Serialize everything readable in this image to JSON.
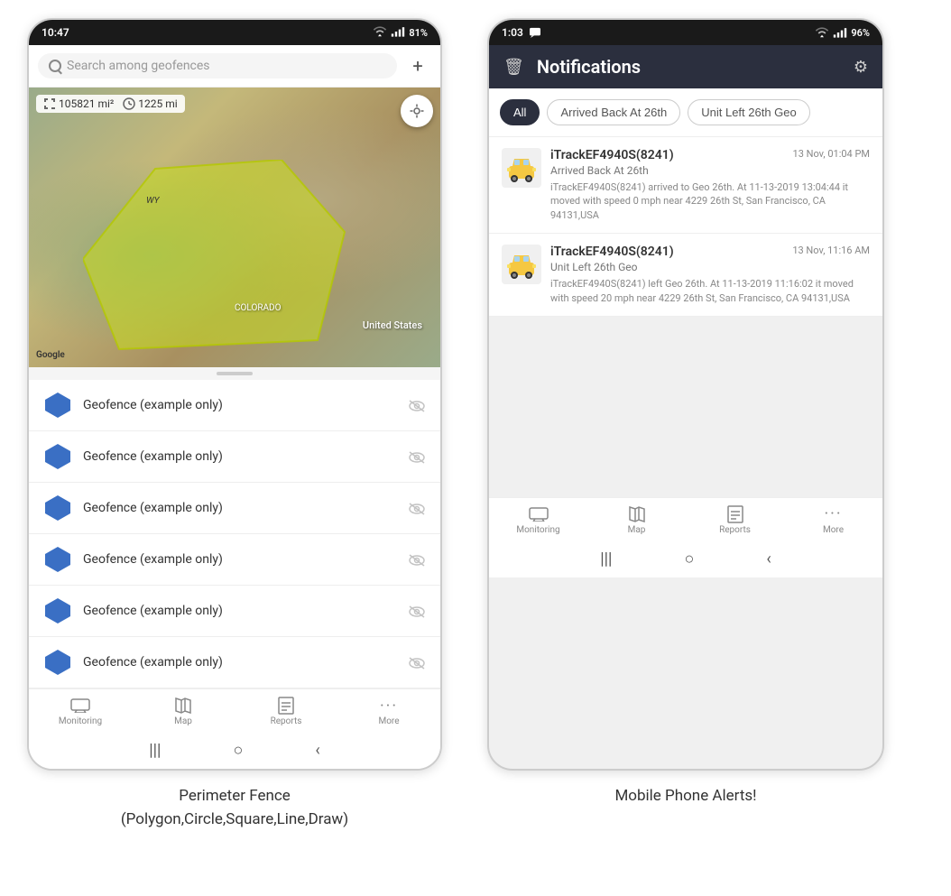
{
  "left_phone": {
    "status_bar": {
      "time": "10:47",
      "signal": "WiFi",
      "battery": "81%"
    },
    "search": {
      "placeholder": "Search among geofences"
    },
    "map": {
      "stats": {
        "area": "105821 mi²",
        "distance": "1225 mi"
      },
      "labels": {
        "country": "United States",
        "state_co": "COLORADO",
        "state_wy": "WY"
      },
      "google": "Google"
    },
    "geofence_items": [
      {
        "label": "Geofence (example only)"
      },
      {
        "label": "Geofence (example only)"
      },
      {
        "label": "Geofence (example only)"
      },
      {
        "label": "Geofence (example only)"
      },
      {
        "label": "Geofence (example only)"
      },
      {
        "label": "Geofence (example only)"
      }
    ],
    "bottom_nav": [
      {
        "label": "Monitoring"
      },
      {
        "label": "Map"
      },
      {
        "label": "Reports"
      },
      {
        "label": "More"
      }
    ]
  },
  "right_phone": {
    "status_bar": {
      "time": "1:03",
      "battery": "96%"
    },
    "header": {
      "title": "Notifications"
    },
    "filters": [
      {
        "label": "All",
        "active": true
      },
      {
        "label": "Arrived Back At 26th",
        "active": false
      },
      {
        "label": "Unit Left 26th Geo",
        "active": false
      }
    ],
    "notifications": [
      {
        "device": "iTrackEF4940S(8241)",
        "time": "13 Nov, 01:04 PM",
        "event": "Arrived Back At 26th",
        "desc": "iTrackEF4940S(8241) arrived to Geo 26th.   At 11-13-2019 13:04:44 it moved with speed 0 mph near 4229 26th St, San Francisco, CA 94131,USA"
      },
      {
        "device": "iTrackEF4940S(8241)",
        "time": "13 Nov, 11:16 AM",
        "event": "Unit Left 26th Geo",
        "desc": "iTrackEF4940S(8241) left Geo 26th.  At 11-13-2019 11:16:02 it moved with speed 20 mph near 4229 26th St, San Francisco, CA 94131,USA"
      }
    ],
    "bottom_nav": [
      {
        "label": "Monitoring"
      },
      {
        "label": "Map"
      },
      {
        "label": "Reports"
      },
      {
        "label": "More"
      }
    ]
  },
  "captions": {
    "left": "Perimeter Fence\n(Polygon,Circle,Square,Line,Draw)",
    "right": "Mobile Phone Alerts!"
  }
}
